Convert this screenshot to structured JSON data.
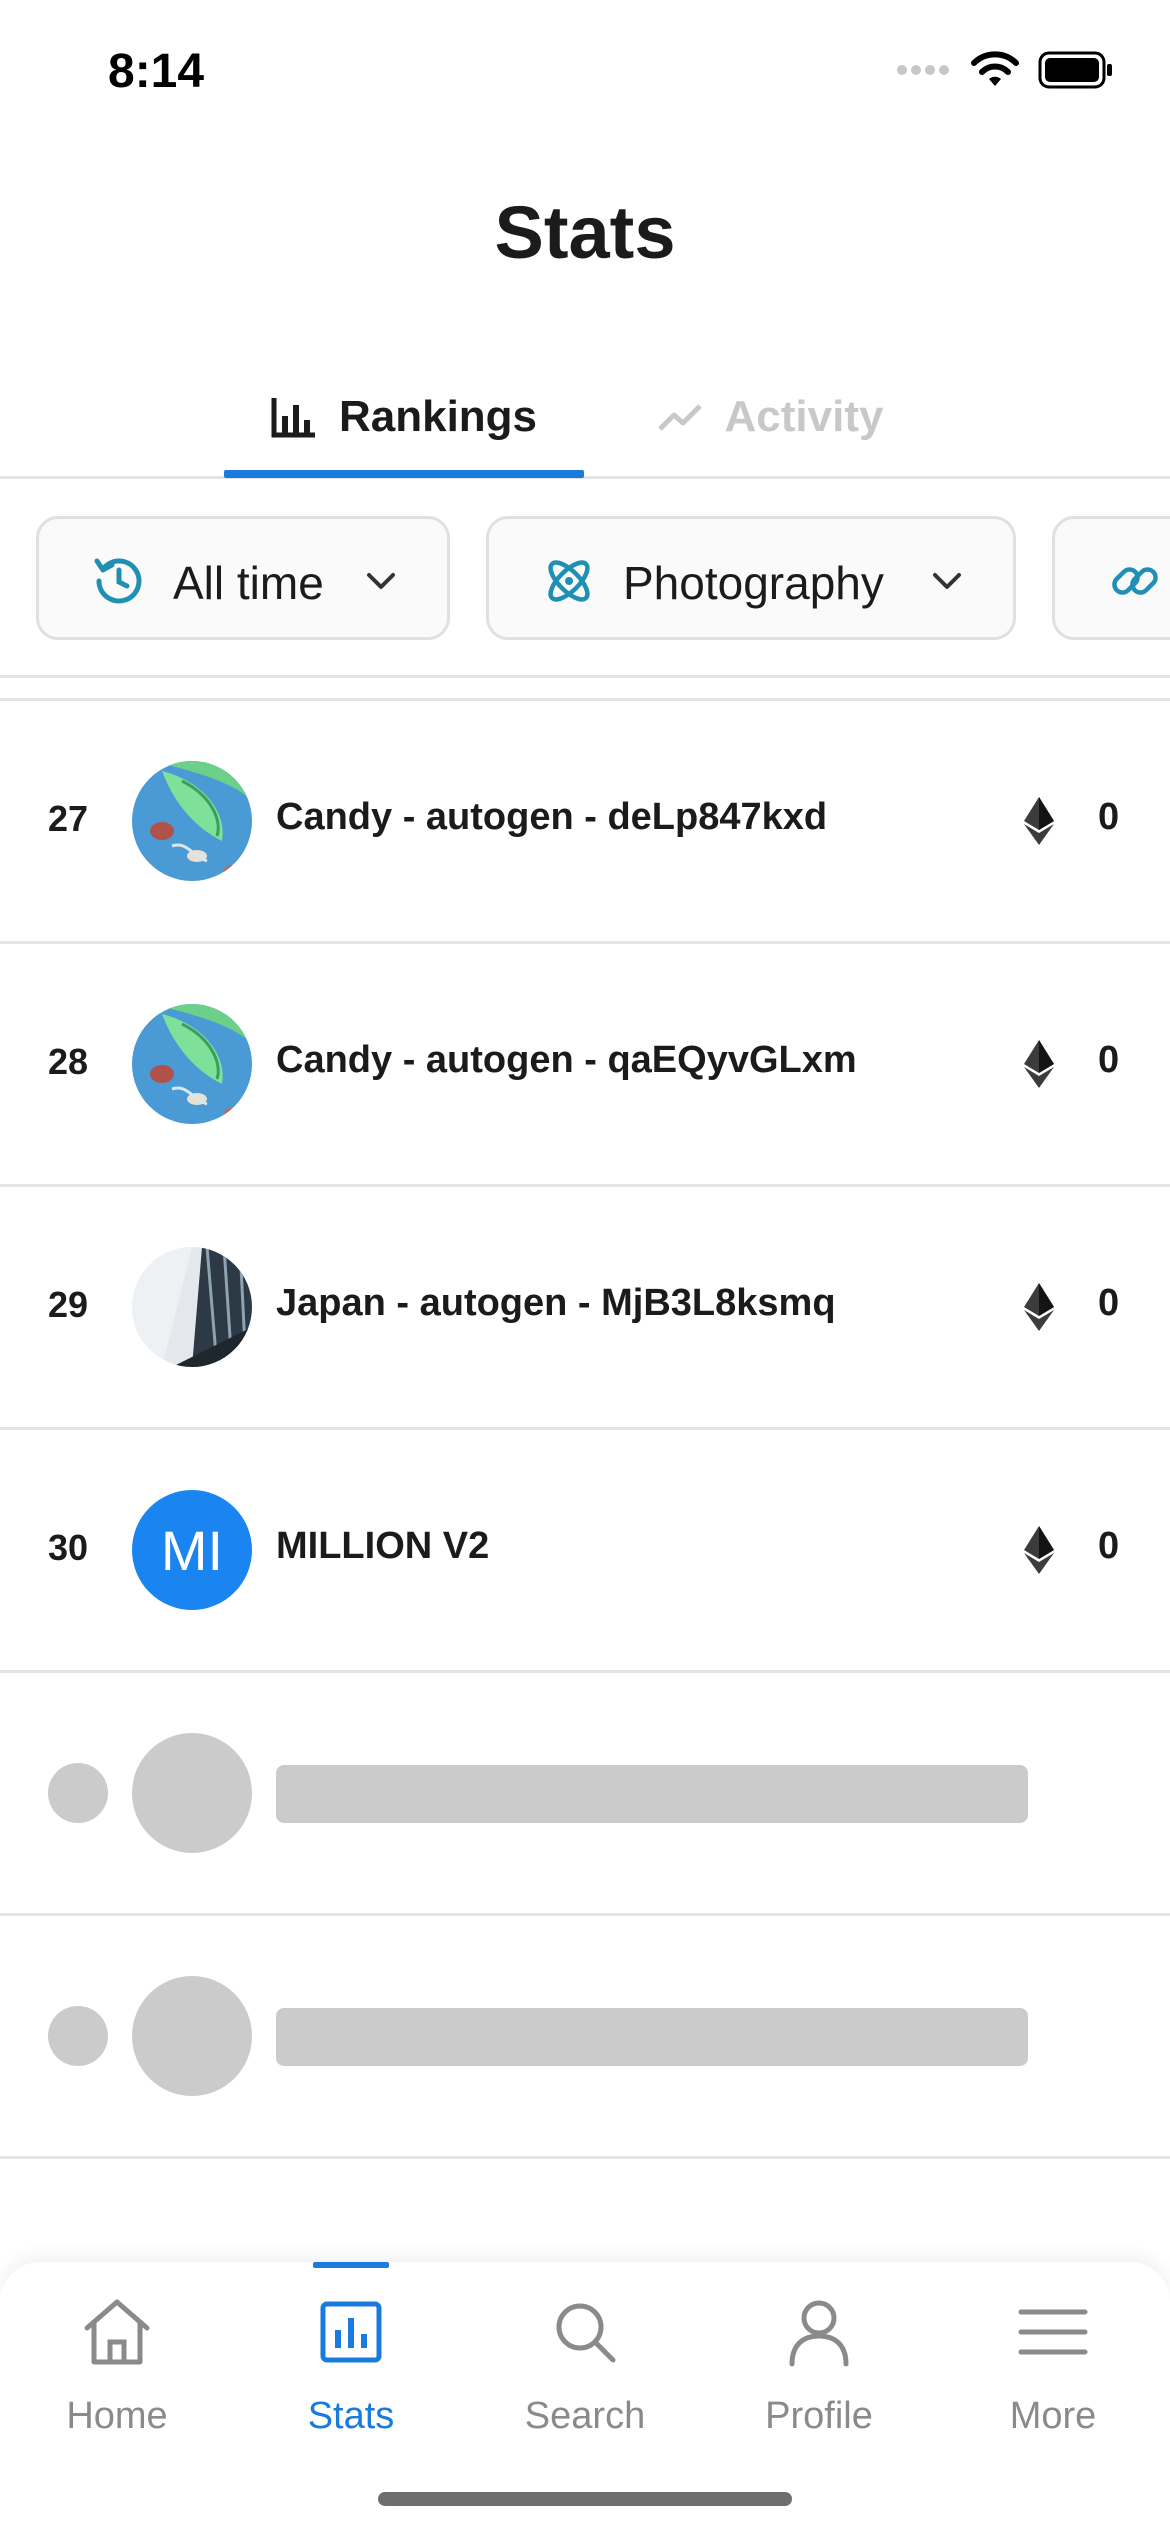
{
  "status_bar": {
    "time": "8:14"
  },
  "header": {
    "title": "Stats"
  },
  "tabs": [
    {
      "label": "Rankings",
      "active": true
    },
    {
      "label": "Activity",
      "active": false
    }
  ],
  "filters": {
    "time": {
      "label": "All time",
      "icon": "time-reset-icon"
    },
    "category": {
      "label": "Photography",
      "icon": "atom-icon"
    },
    "chain": {
      "icon": "link-icon"
    }
  },
  "rankings": [
    {
      "rank": "27",
      "name": "Candy - autogen - deLp847kxd",
      "value": "0",
      "avatar": "candy-art"
    },
    {
      "rank": "28",
      "name": "Candy - autogen - qaEQyvGLxm",
      "value": "0",
      "avatar": "candy-art"
    },
    {
      "rank": "29",
      "name": "Japan - autogen - MjB3L8ksmq",
      "value": "0",
      "avatar": "japan-photo"
    },
    {
      "rank": "30",
      "name": "MILLION V2",
      "value": "0",
      "avatar_initials": "MI"
    }
  ],
  "nav": [
    {
      "label": "Home",
      "icon": "home-icon"
    },
    {
      "label": "Stats",
      "icon": "stats-icon",
      "active": true
    },
    {
      "label": "Search",
      "icon": "search-icon"
    },
    {
      "label": "Profile",
      "icon": "profile-icon"
    },
    {
      "label": "More",
      "icon": "menu-icon"
    }
  ],
  "colors": {
    "accent": "#1a7bdc",
    "filter_icon": "#1f8fb3",
    "skeleton": "#cbcbcb",
    "avatar_bg": "#1a84f0"
  }
}
